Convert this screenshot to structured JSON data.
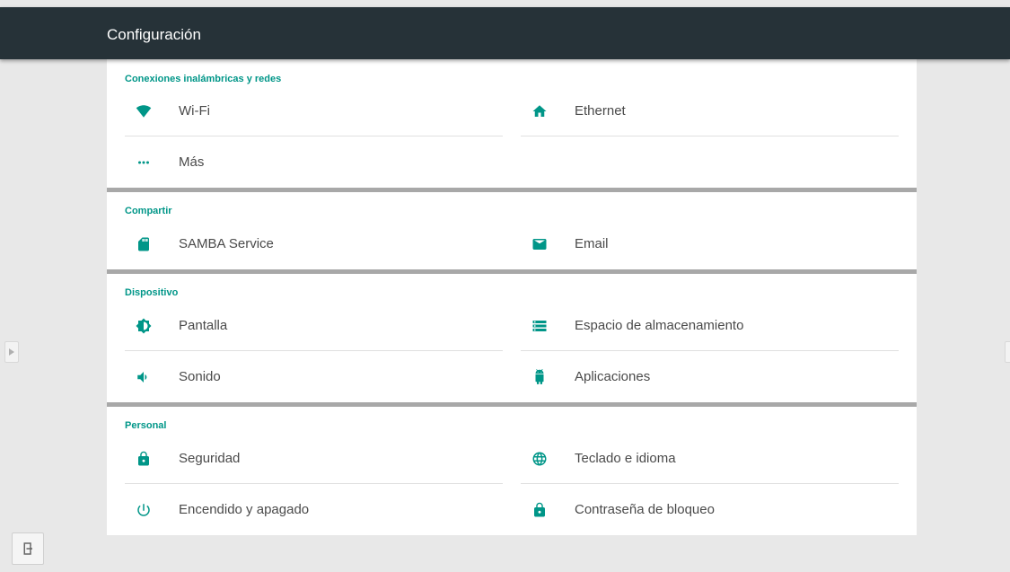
{
  "app": {
    "title": "Configuración"
  },
  "sections": [
    {
      "title": "Conexiones inalámbricas y redes",
      "items": [
        {
          "label": "Wi-Fi",
          "icon": "wifi-icon"
        },
        {
          "label": "Ethernet",
          "icon": "home-icon"
        },
        {
          "label": "Más",
          "icon": "more-dots-icon"
        }
      ]
    },
    {
      "title": "Compartir",
      "items": [
        {
          "label": "SAMBA Service",
          "icon": "sd-card-icon"
        },
        {
          "label": "Email",
          "icon": "email-icon"
        }
      ]
    },
    {
      "title": "Dispositivo",
      "items": [
        {
          "label": "Pantalla",
          "icon": "brightness-icon"
        },
        {
          "label": "Espacio de almacenamiento",
          "icon": "storage-icon"
        },
        {
          "label": "Sonido",
          "icon": "volume-icon"
        },
        {
          "label": "Aplicaciones",
          "icon": "android-icon"
        }
      ]
    },
    {
      "title": "Personal",
      "items": [
        {
          "label": "Seguridad",
          "icon": "lock-icon"
        },
        {
          "label": "Teclado e idioma",
          "icon": "globe-icon"
        },
        {
          "label": "Encendido y apagado",
          "icon": "power-icon"
        },
        {
          "label": "Contraseña de bloqueo",
          "icon": "lock-icon"
        }
      ]
    }
  ],
  "colors": {
    "accent": "#009688",
    "topbar": "#263238",
    "background": "#e8e8e8"
  }
}
